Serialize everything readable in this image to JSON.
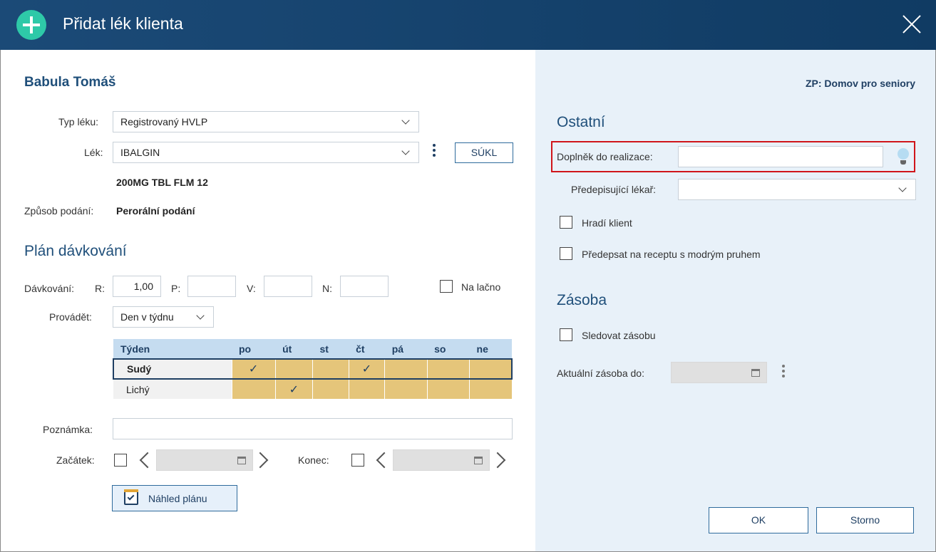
{
  "window": {
    "title": "Přidat lék klienta"
  },
  "client": {
    "name": "Babula Tomáš",
    "zp": "ZP: Domov pro seniory"
  },
  "medication": {
    "typ_label": "Typ léku:",
    "typ_value": "Registrovaný HVLP",
    "lek_label": "Lék:",
    "lek_value": "IBALGIN",
    "sukl_button": "SÚKL",
    "lek_detail": "200MG TBL FLM 12",
    "zpusob_label": "Způsob podání:",
    "zpusob_value": "Perorální podání"
  },
  "plan": {
    "heading": "Plán dávkování",
    "davkovani_label": "Dávkování:",
    "r_label": "R:",
    "r_value": "1,00",
    "p_label": "P:",
    "p_value": "",
    "v_label": "V:",
    "v_value": "",
    "n_label": "N:",
    "n_value": "",
    "nalacno_label": "Na lačno",
    "provadet_label": "Provádět:",
    "provadet_value": "Den v týdnu",
    "table": {
      "headers": [
        "Týden",
        "po",
        "út",
        "st",
        "čt",
        "pá",
        "so",
        "ne"
      ],
      "rows": [
        {
          "week": "Sudý",
          "checks": [
            "✓",
            "",
            "",
            "✓",
            "",
            "",
            ""
          ]
        },
        {
          "week": "Lichý",
          "checks": [
            "",
            "✓",
            "",
            "",
            "",
            "",
            ""
          ]
        }
      ]
    },
    "poznamka_label": "Poznámka:",
    "poznamka_value": "",
    "zacatek_label": "Začátek:",
    "konec_label": "Konec:",
    "nahled_button": "Náhled plánu"
  },
  "ostatni": {
    "heading": "Ostatní",
    "doplnek_label": "Doplněk do realizace:",
    "doplnek_value": "",
    "predepisujici_label": "Předepisující lékař:",
    "predepisujici_value": "",
    "hradi_label": "Hradí klient",
    "predepsat_label": "Předepsat na receptu s modrým pruhem"
  },
  "zasoba": {
    "heading": "Zásoba",
    "sledovat_label": "Sledovat zásobu",
    "aktualni_label": "Aktuální zásoba do:"
  },
  "footer": {
    "ok": "OK",
    "storno": "Storno"
  }
}
